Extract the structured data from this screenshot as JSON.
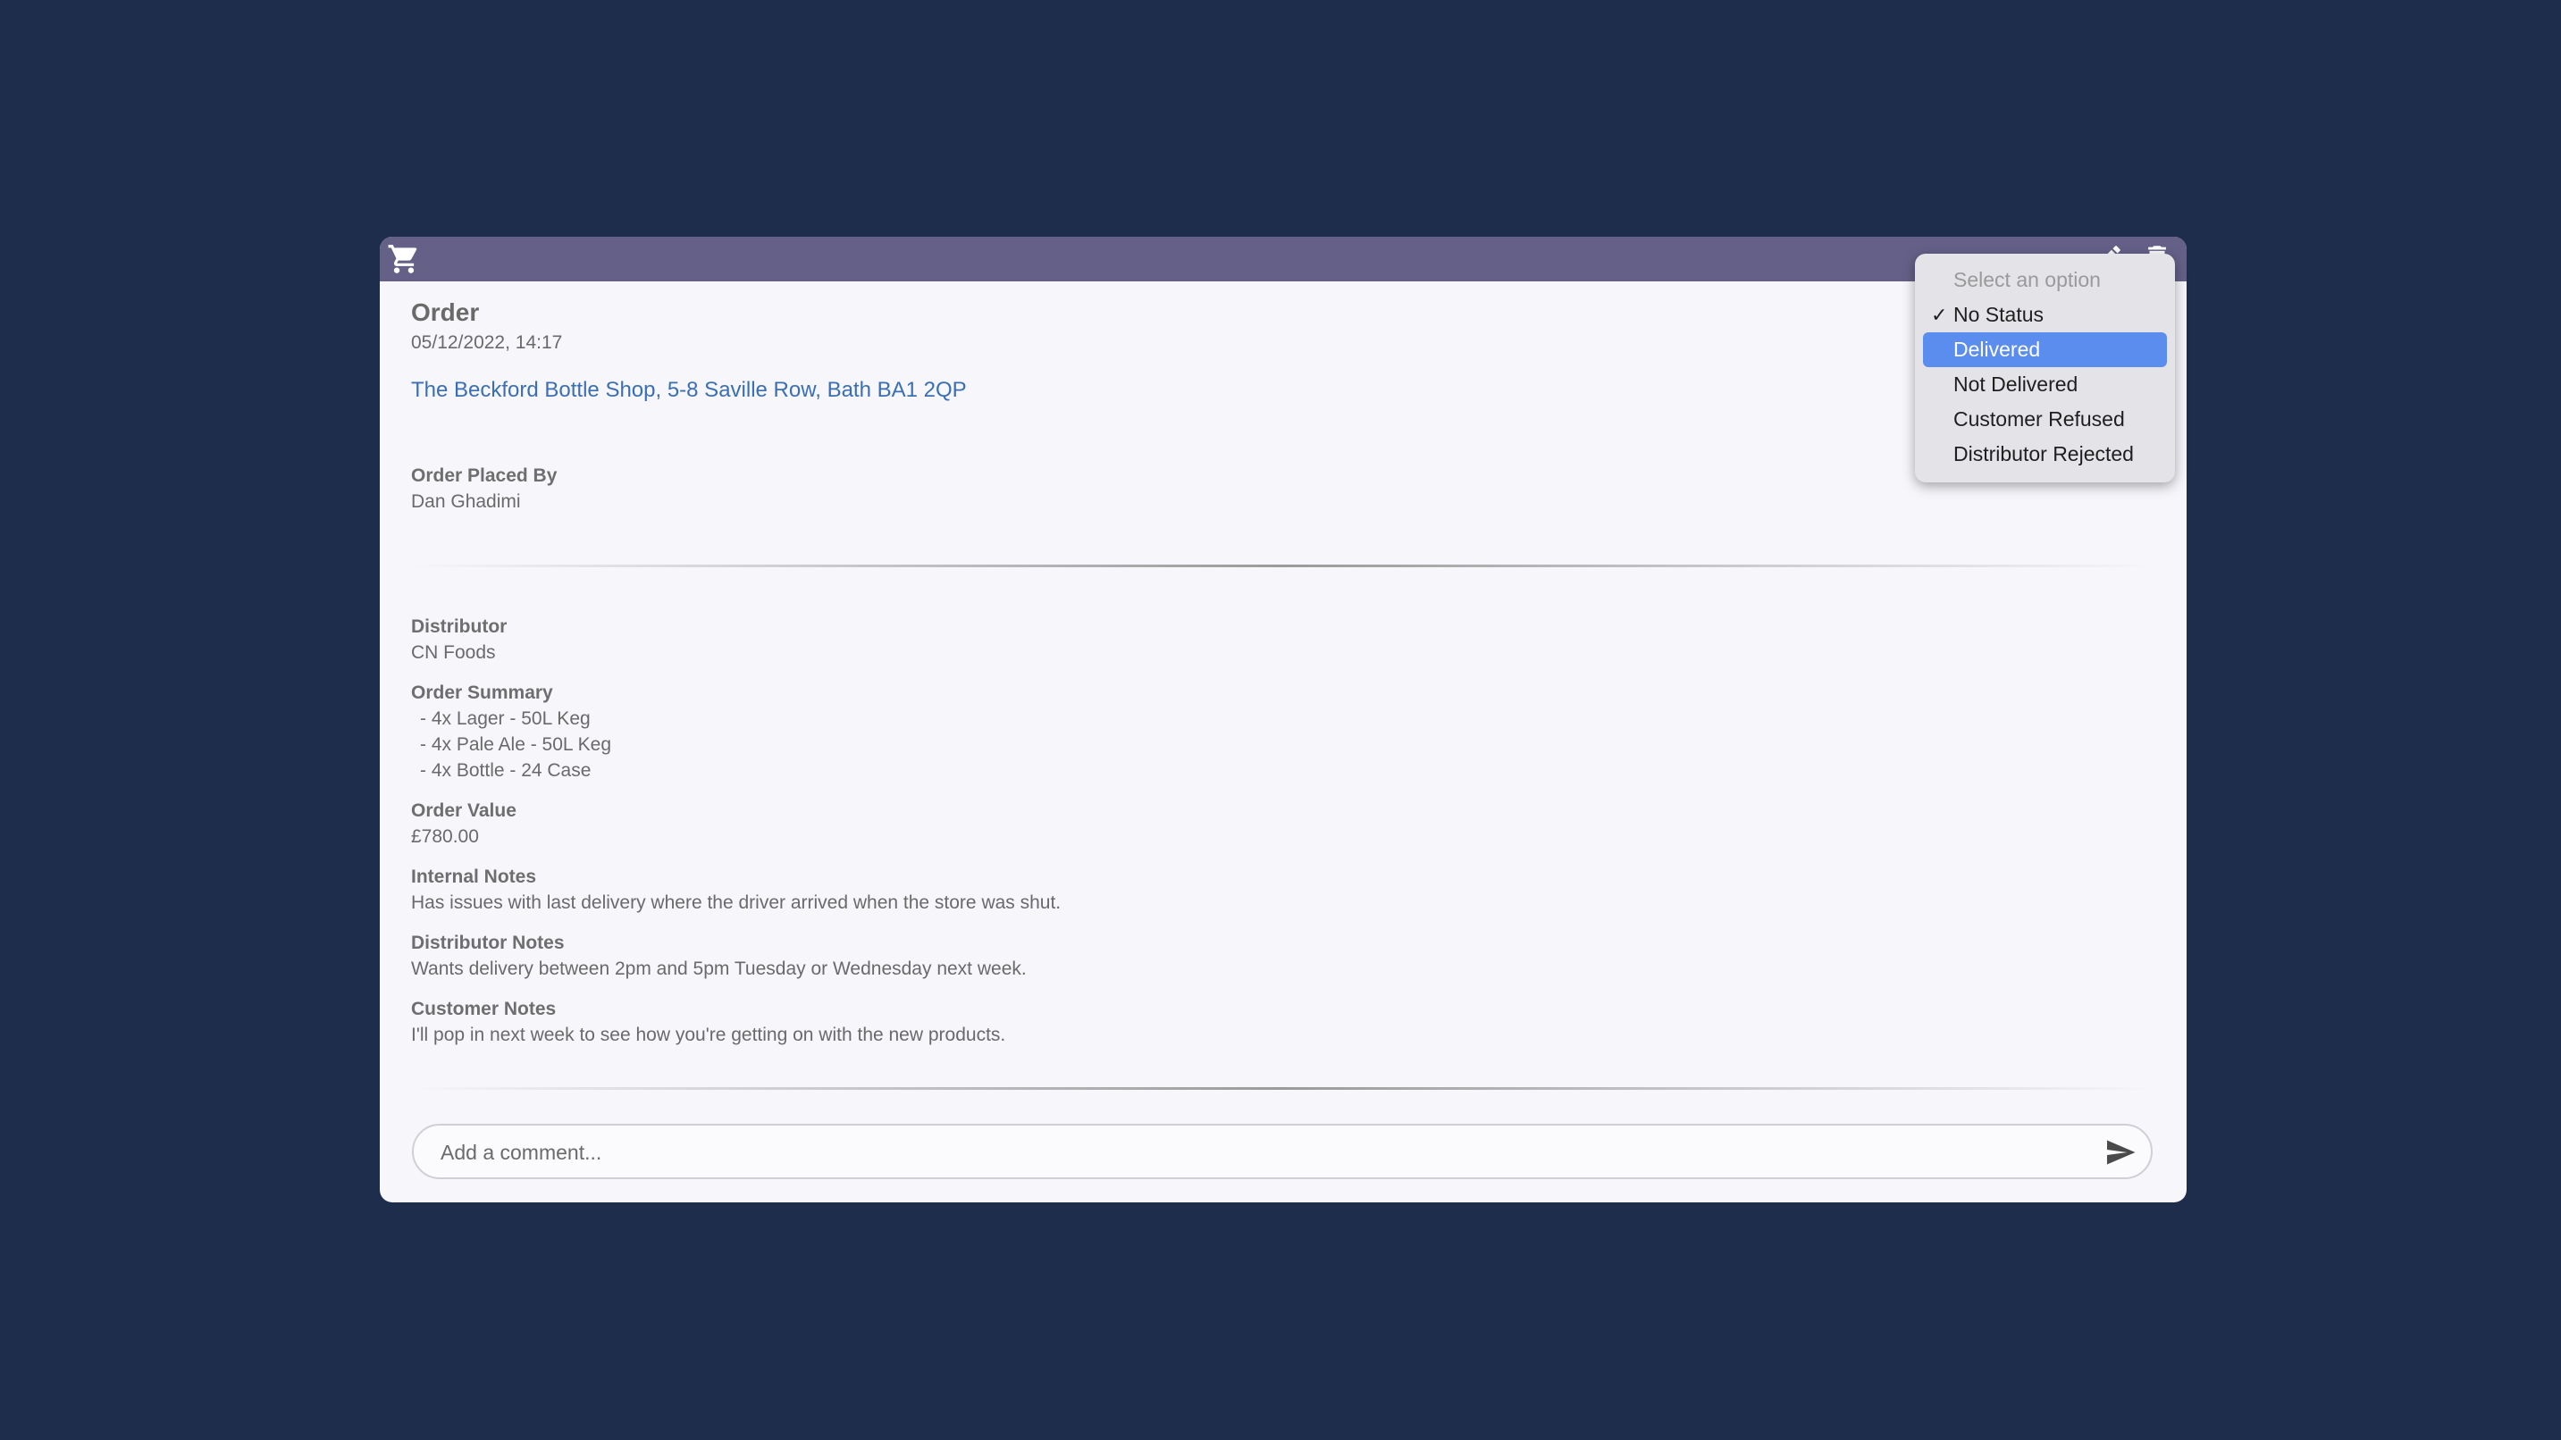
{
  "order": {
    "title": "Order",
    "date": "05/12/2022, 14:17",
    "address": "The Beckford Bottle Shop, 5-8 Saville Row, Bath BA1 2QP",
    "placed_by_label": "Order Placed By",
    "placed_by_value": "Dan Ghadimi",
    "distributor_label": "Distributor",
    "distributor_value": "CN Foods",
    "summary_label": "Order Summary",
    "summary_items": [
      "- 4x Lager - 50L Keg",
      "- 4x Pale Ale - 50L Keg",
      "- 4x Bottle - 24 Case"
    ],
    "value_label": "Order Value",
    "value_value": "£780.00",
    "internal_notes_label": "Internal Notes",
    "internal_notes_value": "Has issues with last delivery where the driver arrived when the store was shut.",
    "distributor_notes_label": "Distributor Notes",
    "distributor_notes_value": "Wants delivery between 2pm and 5pm Tuesday or Wednesday next week.",
    "customer_notes_label": "Customer Notes",
    "customer_notes_value": "I'll pop in next week to see how you're getting on with the new products."
  },
  "comment": {
    "placeholder": "Add a comment..."
  },
  "status_dropdown": {
    "placeholder": "Select an option",
    "selected": "No Status",
    "highlighted": "Delivered",
    "options": [
      "No Status",
      "Delivered",
      "Not Delivered",
      "Customer Refused",
      "Distributor Rejected"
    ],
    "check_glyph": "✓"
  },
  "icons": {
    "header_left": "shopping-cart-icon",
    "header_edit": "pencil-icon",
    "header_delete": "trash-icon",
    "send": "send-icon"
  },
  "colors": {
    "background": "#1e2d4c",
    "header": "#646088",
    "link": "#3a6fb5",
    "highlight": "#5b8def"
  }
}
